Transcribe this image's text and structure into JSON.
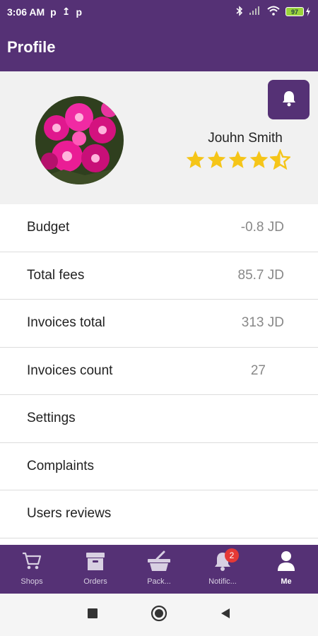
{
  "status_bar": {
    "time": "3:06 AM",
    "left_icons": [
      "p",
      "↥",
      "p"
    ],
    "battery": "97"
  },
  "app_bar": {
    "title": "Profile"
  },
  "profile": {
    "name": "Jouhn Smith",
    "rating": 4.5,
    "rating_max": 5
  },
  "menu": [
    {
      "label": "Budget",
      "value": "-0.8 JD"
    },
    {
      "label": "Total fees",
      "value": "85.7 JD"
    },
    {
      "label": "Invoices total",
      "value": "313 JD"
    },
    {
      "label": "Invoices count",
      "value": "27"
    },
    {
      "label": "Settings",
      "value": ""
    },
    {
      "label": "Complaints",
      "value": ""
    },
    {
      "label": "Users reviews",
      "value": ""
    }
  ],
  "bottom_nav": [
    {
      "label": "Shops",
      "icon": "cart-icon"
    },
    {
      "label": "Orders",
      "icon": "archive-box-icon"
    },
    {
      "label": "Pack...",
      "icon": "basket-icon"
    },
    {
      "label": "Notific...",
      "icon": "bell-icon",
      "badge": "2"
    },
    {
      "label": "Me",
      "icon": "user-icon",
      "active": true
    }
  ],
  "colors": {
    "primary": "#553175",
    "star": "#f5c518",
    "badge": "#e53935"
  }
}
